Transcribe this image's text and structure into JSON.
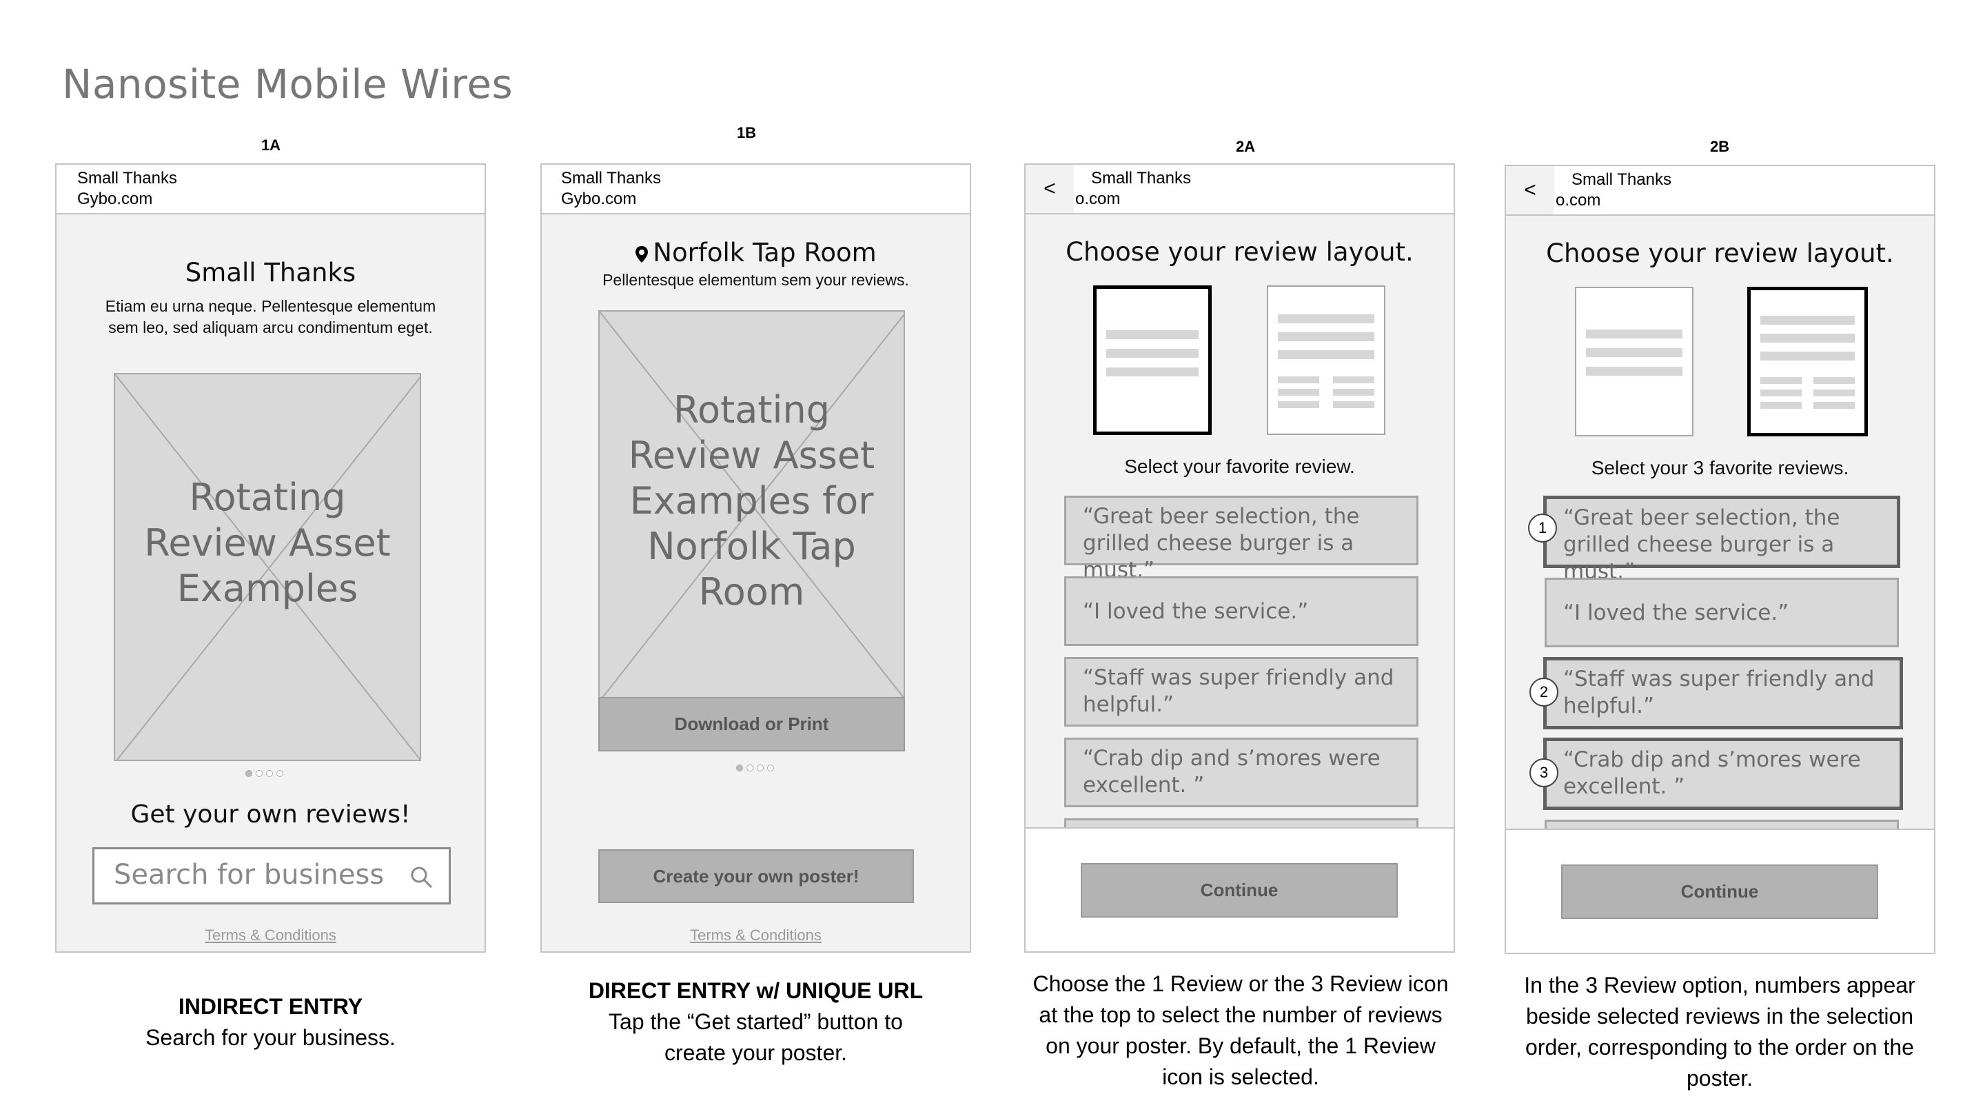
{
  "page_title": "Nanosite Mobile Wires",
  "frames": {
    "f1a": {
      "label": "1A",
      "app_name": "Small Thanks",
      "domain": "Gybo.com",
      "heading": "Small Thanks",
      "desc_line1": "Etiam eu urna neque. Pellentesque elementum",
      "desc_line2": "sem leo, sed aliquam arcu condimentum eget.",
      "placeholder": [
        "Rotating",
        "Review Asset",
        "Examples"
      ],
      "cta_heading": "Get your own reviews!",
      "search_placeholder": "Search for business",
      "terms": "Terms & Conditions",
      "caption_title": "INDIRECT ENTRY",
      "caption_body": "Search for your business."
    },
    "f1b": {
      "label": "1B",
      "app_name": "Small Thanks",
      "domain": "Gybo.com",
      "heading": "Norfolk Tap Room",
      "subheading": "Pellentesque elementum sem your reviews.",
      "placeholder": [
        "Rotating",
        "Review Asset",
        "Examples for",
        "Norfolk Tap",
        "Room"
      ],
      "download_label": "Download or Print",
      "create_label": "Create your own poster!",
      "terms": "Terms & Conditions",
      "caption_title": "DIRECT ENTRY w/ UNIQUE URL",
      "caption_line1": "Tap the “Get started” button to",
      "caption_line2": "create your poster."
    },
    "f2a": {
      "label": "2A",
      "back": "<",
      "app_name": "Small Thanks",
      "domain": "o.com",
      "heading": "Choose your review layout.",
      "select_prompt": "Select your favorite review.",
      "reviews": [
        "“Great beer selection, the grilled cheese burger is a must.”",
        "“I loved the service.”",
        "“Staff was super friendly and helpful.”",
        "“Crab dip and s’mores were excellent. ”"
      ],
      "continue_label": "Continue",
      "caption_lines": [
        "Choose the 1 Review or the 3 Review icon",
        "at the top to select the number of reviews",
        "on your poster. By default, the 1 Review",
        "icon is selected."
      ]
    },
    "f2b": {
      "label": "2B",
      "back": "<",
      "app_name": "Small Thanks",
      "domain": "o.com",
      "heading": "Choose your review layout.",
      "select_prompt": "Select your 3 favorite reviews.",
      "reviews": [
        "“Great beer selection, the grilled cheese burger is a must.”",
        "“I loved the service.”",
        "“Staff was super friendly and helpful.”",
        "“Crab dip and s’mores were excellent. ”"
      ],
      "numbers": [
        "1",
        "2",
        "3"
      ],
      "continue_label": "Continue",
      "caption_lines": [
        "In the 3 Review option, numbers appear",
        "beside selected reviews in the selection",
        "order, corresponding to the order on the",
        "poster."
      ]
    }
  },
  "icons": {
    "search": "magnifier-icon",
    "pin": "map-pin-icon",
    "carousel": "carousel-dots-icon"
  }
}
